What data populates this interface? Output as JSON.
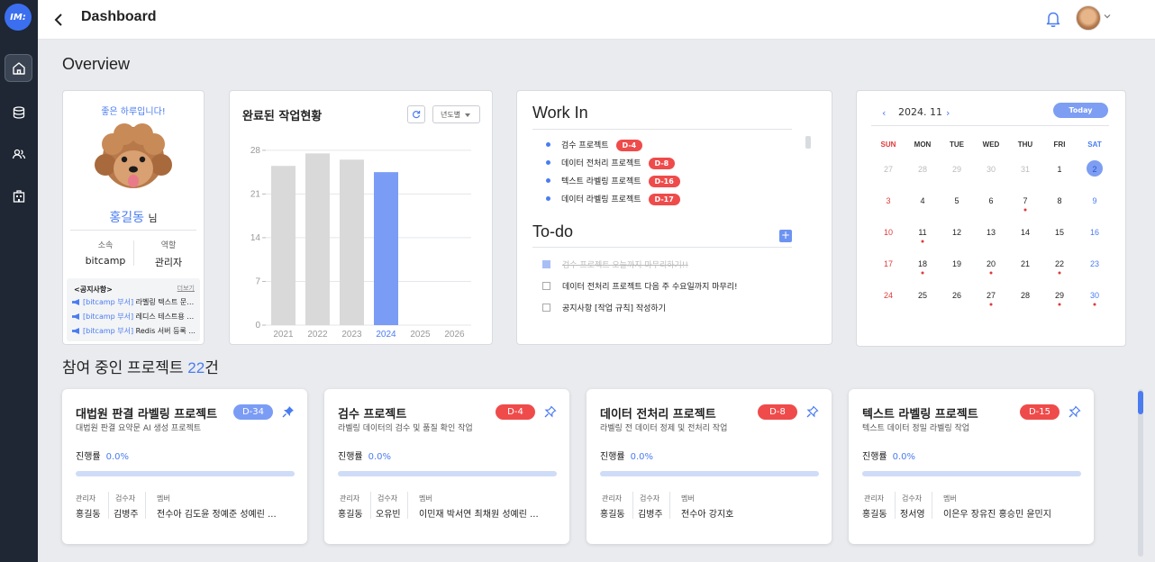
{
  "sidebar": {
    "logo": "IM:",
    "items": [
      {
        "icon": "home-icon",
        "active": true
      },
      {
        "icon": "database-icon",
        "active": false
      },
      {
        "icon": "users-icon",
        "active": false
      },
      {
        "icon": "building-icon",
        "active": false
      }
    ]
  },
  "header": {
    "title": "Dashboard"
  },
  "overview_title": "Overview",
  "profile": {
    "greeting": "좋은 하루입니다!",
    "name": "홍길동",
    "honorific": "님",
    "affiliation_label": "소속",
    "affiliation": "bitcamp",
    "role_label": "역할",
    "role": "관리자",
    "notice_title": "<공지사항>",
    "notice_more": "더보기",
    "notices": [
      {
        "tag": "[bitcamp 부서]",
        "text": "라벨링 텍스트 문법..."
      },
      {
        "tag": "[bitcamp 부서]",
        "text": "레디스 테스트용 공..."
      },
      {
        "tag": "[bitcamp 부서]",
        "text": "Redis 서버 등록 ..."
      }
    ]
  },
  "chart_card": {
    "title": "완료된 작업현황",
    "period_select": "년도별"
  },
  "chart_data": {
    "type": "bar",
    "title": "완료된 작업현황",
    "categories": [
      "2021",
      "2022",
      "2023",
      "2024",
      "2025",
      "2026"
    ],
    "values": [
      25.5,
      27.5,
      26.5,
      24.5,
      0,
      0
    ],
    "highlight_index": 3,
    "yticks": [
      0,
      7,
      14,
      21,
      28
    ],
    "ylim": [
      0,
      30
    ],
    "colors": {
      "default": "#d9d9d9",
      "highlight": "#7b9cf5"
    },
    "grid": true
  },
  "work_in": {
    "title": "Work In",
    "items": [
      {
        "name": "검수 프로젝트",
        "badge": "D-4"
      },
      {
        "name": "데이터 전처리 프로젝트",
        "badge": "D-8"
      },
      {
        "name": "텍스트 라벨링 프로젝트",
        "badge": "D-16"
      },
      {
        "name": "데이터 라벨링 프로젝트",
        "badge": "D-17"
      }
    ]
  },
  "todo": {
    "title": "To-do",
    "add_label": "+",
    "items": [
      {
        "text": "검수 프로젝트 오늘까지 마무리하기!!",
        "done": true
      },
      {
        "text": "데이터 전처리 프로젝트 다음 주 수요일까지 마무리!",
        "done": false
      },
      {
        "text": "공지사항 [작업 규칙] 작성하기",
        "done": false
      }
    ]
  },
  "calendar": {
    "prev": "‹",
    "next": "›",
    "month_label": "2024. 11",
    "today_label": "Today",
    "weekdays": [
      "SUN",
      "MON",
      "TUE",
      "WED",
      "THU",
      "FRI",
      "SAT"
    ],
    "weeks": [
      [
        "27",
        "28",
        "29",
        "30",
        "31",
        "1",
        "2"
      ],
      [
        "3",
        "4",
        "5",
        "6",
        "7",
        "8",
        "9"
      ],
      [
        "10",
        "11",
        "12",
        "13",
        "14",
        "15",
        "16"
      ],
      [
        "17",
        "18",
        "19",
        "20",
        "21",
        "22",
        "23"
      ],
      [
        "24",
        "25",
        "26",
        "27",
        "28",
        "29",
        "30"
      ]
    ],
    "muted_cells": [
      "0-0",
      "0-1",
      "0-2",
      "0-3",
      "0-4"
    ],
    "selected_cell": "0-6",
    "event_days": [
      "7",
      "11",
      "18",
      "20",
      "22",
      "27",
      "29",
      "30"
    ]
  },
  "projects": {
    "heading_prefix": "참여 중인 프로젝트 ",
    "count": "22",
    "heading_suffix": "건",
    "progress_label": "진행률",
    "manager_label": "관리자",
    "reviewer_label": "검수자",
    "member_label": "멤버",
    "cards": [
      {
        "name": "대법원 판결 라벨링 프로젝트",
        "desc": "대법원 판결 요약문 AI 생성 프로젝트",
        "badge": "D-34",
        "badge_color": "#7b9cf5",
        "progress": "0.0%",
        "progress_value": 0,
        "manager": "홍길동",
        "reviewer": "김병주",
        "members": "전수아 김도윤 정예준 성예린 ..."
      },
      {
        "name": "검수 프로젝트",
        "desc": "라벨링 데이터의 검수 및 품질 확인 작업",
        "badge": "D-4",
        "badge_color": "#ef4b4b",
        "progress": "0.0%",
        "progress_value": 0,
        "manager": "홍길동",
        "reviewer": "오유빈",
        "members": "이민재 박서연 최채원 성예린 ..."
      },
      {
        "name": "데이터 전처리 프로젝트",
        "desc": "라벨링 전 데이터 정제 및 전처리 작업",
        "badge": "D-8",
        "badge_color": "#ef4b4b",
        "progress": "0.0%",
        "progress_value": 0,
        "manager": "홍길동",
        "reviewer": "김병주",
        "members": "전수아 강지호"
      },
      {
        "name": "텍스트 라벨링 프로젝트",
        "desc": "텍스트 데이터 정밀 라벨링 작업",
        "badge": "D-15",
        "badge_color": "#ef4b4b",
        "progress": "0.0%",
        "progress_value": 0,
        "manager": "홍길동",
        "reviewer": "정서영",
        "members": "이은우 장유진 홍승민 윤민지"
      }
    ]
  }
}
